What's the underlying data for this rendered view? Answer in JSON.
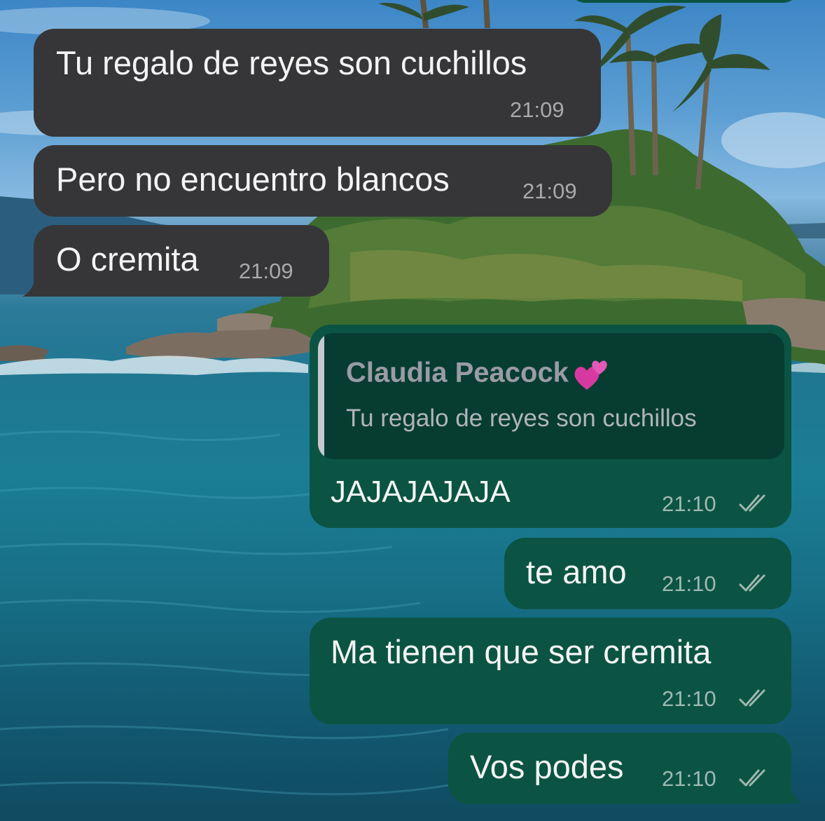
{
  "chat": {
    "incoming": [
      {
        "text": "Tu regalo de reyes son cuchillos",
        "time": "21:09"
      },
      {
        "text": "Pero no encuentro blancos",
        "time": "21:09"
      },
      {
        "text": "O cremita",
        "time": "21:09"
      }
    ],
    "reply": {
      "quoted_author": "Claudia Peacock",
      "quoted_text": "Tu regalo de reyes son cuchillos",
      "text": "JAJAJAJAJA",
      "time": "21:10",
      "status": "read"
    },
    "outgoing": [
      {
        "text": "te amo",
        "time": "21:10",
        "status": "read"
      },
      {
        "text": "Ma tienen que ser cremita",
        "time": "21:10",
        "status": "read"
      },
      {
        "text": "Vos podes",
        "time": "21:10",
        "status": "read"
      }
    ]
  },
  "icons": {
    "read_receipt": "double-check-icon",
    "author_emoji": "two-hearts-icon"
  },
  "colors": {
    "incoming_bubble": "#363638",
    "outgoing_bubble": "#0b5443",
    "quote_background": "#073d30",
    "quote_bar": "#c6c8d0",
    "hearts": "#d63aa0"
  }
}
